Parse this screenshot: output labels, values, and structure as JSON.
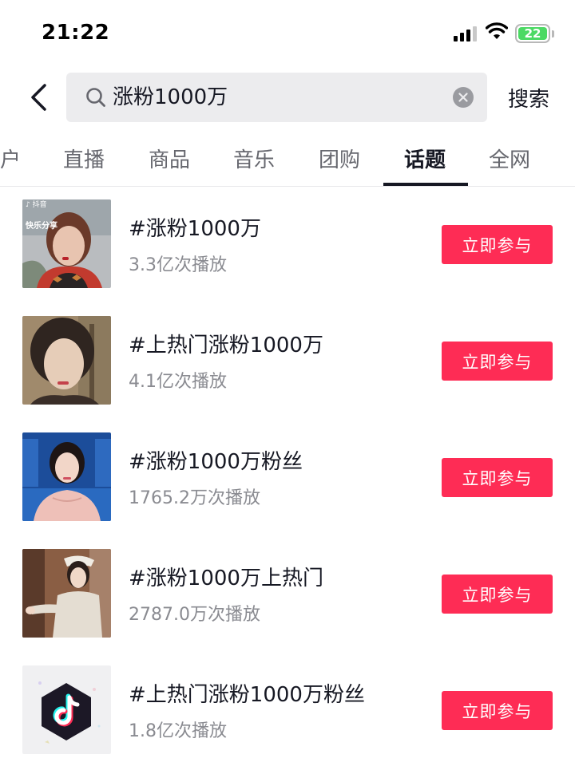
{
  "status_bar": {
    "time": "21:22",
    "battery": "22"
  },
  "search": {
    "query": "涨粉1000万",
    "submit_label": "搜索"
  },
  "tabs": [
    {
      "label": "户"
    },
    {
      "label": "直播"
    },
    {
      "label": "商品"
    },
    {
      "label": "音乐"
    },
    {
      "label": "团购"
    },
    {
      "label": "话题",
      "active": true
    },
    {
      "label": "全网"
    }
  ],
  "thumb_overlay": {
    "brand": "抖音",
    "caption": "快乐分享"
  },
  "topics": [
    {
      "title": "#涨粉1000万",
      "plays": "3.3亿次播放",
      "action": "立即参与"
    },
    {
      "title": "#上热门涨粉1000万",
      "plays": "4.1亿次播放",
      "action": "立即参与"
    },
    {
      "title": "#涨粉1000万粉丝",
      "plays": "1765.2万次播放",
      "action": "立即参与"
    },
    {
      "title": "#涨粉1000万上热门",
      "plays": "2787.0万次播放",
      "action": "立即参与"
    },
    {
      "title": "#上热门涨粉1000万粉丝",
      "plays": "1.8亿次播放",
      "action": "立即参与"
    }
  ],
  "colors": {
    "accent": "#fe2c55",
    "text": "#161823",
    "secondary": "#8a8b91",
    "battery": "#4cd964"
  },
  "icons": [
    "back-arrow-icon",
    "search-icon",
    "clear-icon",
    "signal-icon",
    "wifi-icon",
    "battery-icon",
    "tiktok-logo-icon"
  ]
}
